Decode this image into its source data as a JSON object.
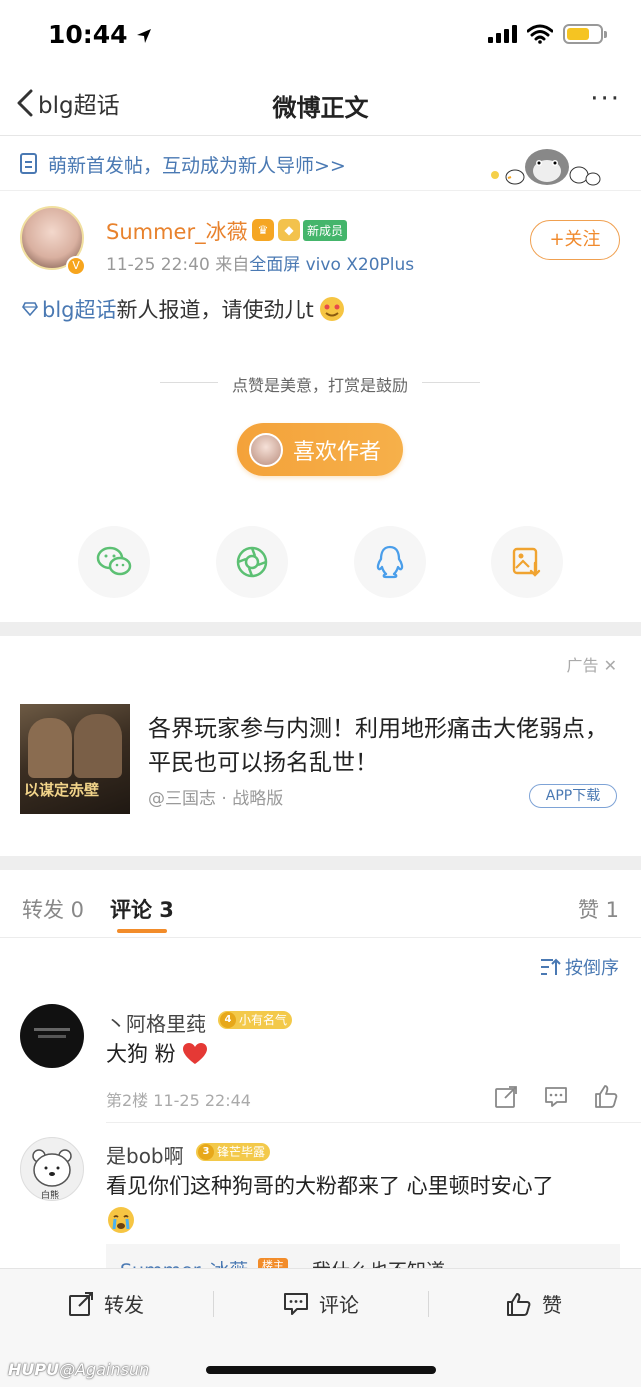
{
  "status_bar": {
    "time": "10:44"
  },
  "nav": {
    "back_label": "blg超话",
    "title": "微博正文",
    "more": "···"
  },
  "banner": {
    "text": "萌新首发帖，互动成为新人导师>>"
  },
  "post": {
    "username": "Summer_冰薇",
    "badge_new": "新成员",
    "time": "11-25 22:40",
    "source_prefix": "来自",
    "source": "全面屏 vivo X20Plus",
    "follow_label": "+关注",
    "topic": "blg超话",
    "text": "新人报道，请使劲儿t",
    "reward_hint": "点赞是美意，打赏是鼓励",
    "like_author_label": "喜欢作者"
  },
  "share": {
    "items": [
      {
        "icon": "wechat-icon"
      },
      {
        "icon": "moments-icon"
      },
      {
        "icon": "qq-icon"
      },
      {
        "icon": "save-image-icon"
      }
    ]
  },
  "ad": {
    "label": "广告",
    "close": "✕",
    "title": "各界玩家参与内测！利用地形痛击大佬弱点，平民也可以扬名乱世！",
    "source": "@三国志 · 战略版",
    "button": "APP下载",
    "image_caption": "以谋定赤壁"
  },
  "tabs": {
    "repost": "转发 0",
    "comment": "评论 3",
    "like": "赞 1"
  },
  "sort_label": "按倒序",
  "comments": [
    {
      "name": "丶阿格里莼",
      "badge_level": "4",
      "badge_text": "小有名气",
      "text": "大狗 粉",
      "meta": "第2楼 11-25 22:44"
    },
    {
      "name": "是bob啊",
      "badge_level": "3",
      "badge_text": "锋芒毕露",
      "text": "看见你们这种狗哥的大粉都来了 心里顿时安心了",
      "avatar_label": "白熊"
    }
  ],
  "reply_preview": {
    "name": "Summer_冰薇",
    "tag": "楼主",
    "text": "我什么也不知道"
  },
  "bottom_bar": {
    "repost": "转发",
    "comment": "评论",
    "like": "赞"
  },
  "watermark": {
    "brand": "HUPU",
    "handle": "@Againsun"
  },
  "colors": {
    "accent_orange": "#f28c2a",
    "link_blue": "#4a79b3",
    "username_orange": "#e8822d"
  }
}
